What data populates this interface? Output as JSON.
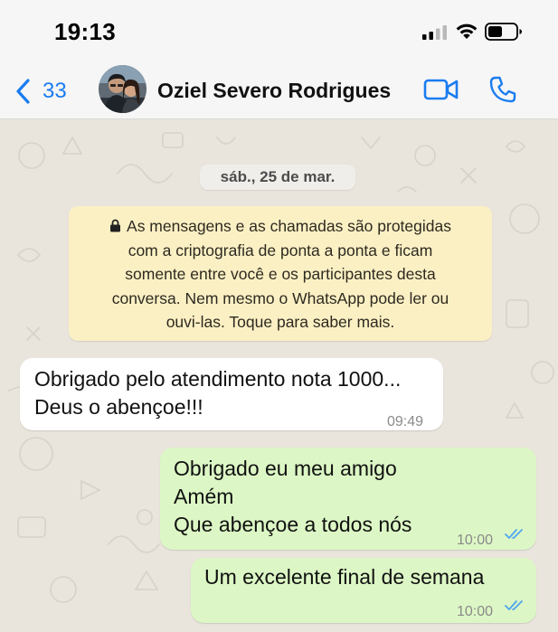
{
  "status_bar": {
    "time": "19:13"
  },
  "header": {
    "back_count": "33",
    "contact_name": "Oziel Severo Rodrigues"
  },
  "colors": {
    "accent": "#1a7cf0",
    "outgoing_bubble": "#dcf7c5",
    "incoming_bubble": "#ffffff",
    "notice_bg": "#fbf0c4",
    "read_ticks": "#4fa5ee"
  },
  "chat": {
    "date_label": "sáb., 25 de mar.",
    "encryption_notice": {
      "lines": [
        "As mensagens e as chamadas são protegidas",
        "com a criptografia de ponta a ponta e ficam",
        "somente entre você e os participantes desta",
        "conversa. Nem mesmo o WhatsApp pode ler ou",
        "ouvi-las. Toque para saber mais."
      ]
    },
    "messages": [
      {
        "direction": "incoming",
        "lines": [
          "Obrigado pelo atendimento nota 1000...",
          "Deus o abençoe!!!"
        ],
        "time": "09:49"
      },
      {
        "direction": "outgoing",
        "lines": [
          "Obrigado eu meu amigo",
          "Amém",
          "Que abençoe a todos nós"
        ],
        "time": "10:00",
        "status": "read"
      },
      {
        "direction": "outgoing",
        "lines": [
          "Um excelente final de semana"
        ],
        "time": "10:00",
        "status": "read"
      }
    ]
  },
  "icons": [
    "lock-icon",
    "chevron-left-icon",
    "video-camera-icon",
    "phone-icon",
    "signal-icon",
    "wifi-icon",
    "battery-icon",
    "double-check-icon"
  ]
}
